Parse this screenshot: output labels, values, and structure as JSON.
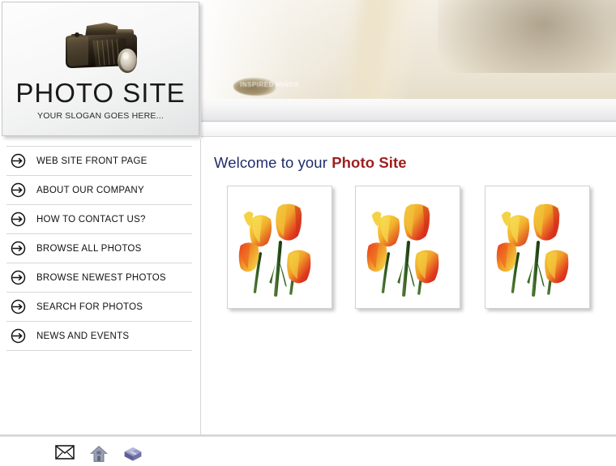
{
  "logo": {
    "title": "PHOTO SITE",
    "slogan": "YOUR SLOGAN GOES HERE...",
    "camera_icon": "camera-icon"
  },
  "banner": {
    "watermark": "INSPIRED MINDS"
  },
  "sidebar": {
    "items": [
      {
        "label": "WEB SITE FRONT PAGE",
        "icon": "arrow-right-circle-icon"
      },
      {
        "label": "ABOUT OUR COMPANY",
        "icon": "arrow-right-circle-icon"
      },
      {
        "label": "HOW TO CONTACT US?",
        "icon": "arrow-right-circle-icon"
      },
      {
        "label": "BROWSE ALL PHOTOS",
        "icon": "arrow-right-circle-icon"
      },
      {
        "label": "BROWSE NEWEST PHOTOS",
        "icon": "arrow-right-circle-icon"
      },
      {
        "label": "SEARCH FOR PHOTOS",
        "icon": "arrow-right-circle-icon"
      },
      {
        "label": "NEWS AND EVENTS",
        "icon": "arrow-right-circle-icon"
      }
    ]
  },
  "main": {
    "heading_prefix": "Welcome to your",
    "heading_accent": "Photo Site",
    "photos": [
      {
        "alt": "tulips-photo-1"
      },
      {
        "alt": "tulips-photo-2"
      },
      {
        "alt": "tulips-photo-3"
      }
    ]
  },
  "footer": {
    "icons": [
      {
        "name": "email-icon"
      },
      {
        "name": "home-icon"
      },
      {
        "name": "package-icon"
      }
    ]
  },
  "colors": {
    "heading_blue": "#1f2d6b",
    "heading_red": "#9e1f1f",
    "banner_beige": "#ece5d5",
    "divider": "#d5d5d7"
  }
}
